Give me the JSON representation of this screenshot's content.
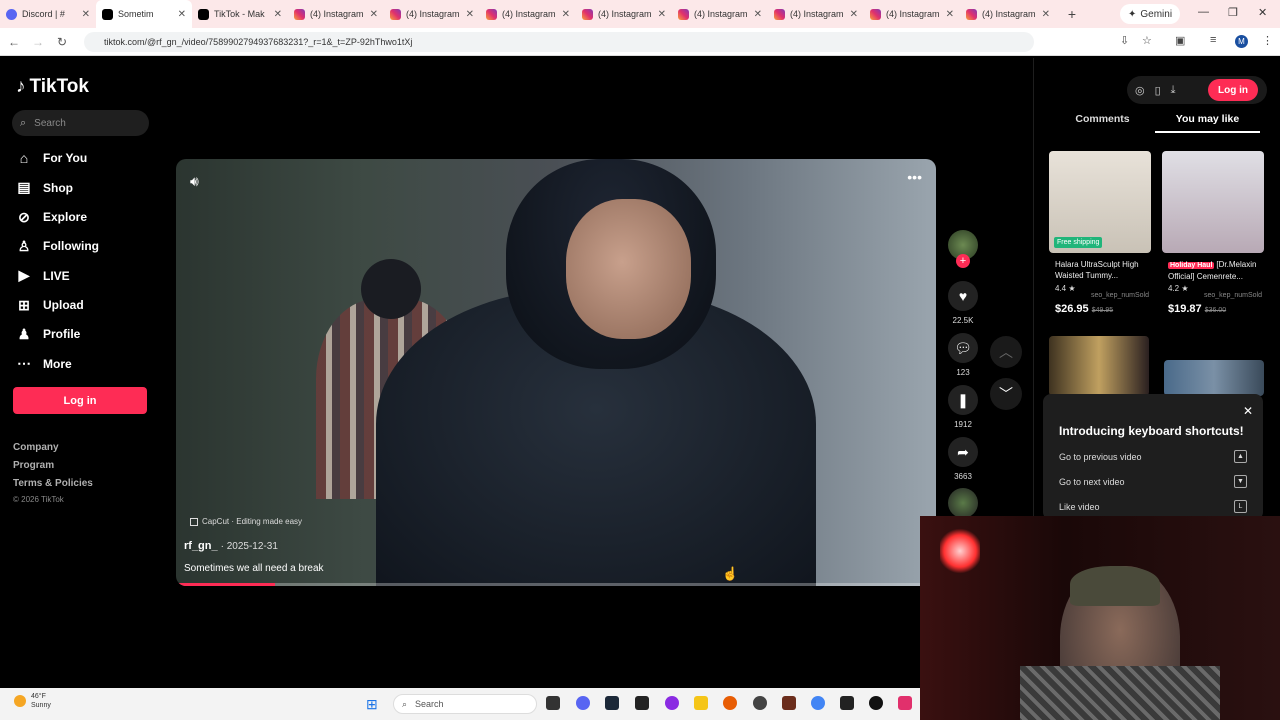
{
  "browser": {
    "tabs": [
      {
        "title": "Discord | #",
        "kind": "dc"
      },
      {
        "title": "Sometim",
        "kind": "tt",
        "active": true
      },
      {
        "title": "TikTok - Mak",
        "kind": "tt"
      },
      {
        "title": "(4) Instagram",
        "kind": "ig"
      },
      {
        "title": "(4) Instagram",
        "kind": "ig"
      },
      {
        "title": "(4) Instagram",
        "kind": "ig"
      },
      {
        "title": "(4) Instagram",
        "kind": "ig"
      },
      {
        "title": "(4) Instagram",
        "kind": "ig"
      },
      {
        "title": "(4) Instagram",
        "kind": "ig"
      },
      {
        "title": "(4) Instagram",
        "kind": "ig"
      },
      {
        "title": "(4) Instagram",
        "kind": "ig"
      }
    ],
    "gemini_label": "Gemini",
    "url": "tiktok.com/@rf_gn_/video/7589902794937683231?_r=1&_t=ZP-92hThwo1tXj",
    "account_initial": "M"
  },
  "sidebar": {
    "logo": "TikTok",
    "search_placeholder": "Search",
    "nav": [
      {
        "label": "For You",
        "icon": "home-icon"
      },
      {
        "label": "Shop",
        "icon": "shop-icon"
      },
      {
        "label": "Explore",
        "icon": "compass-icon"
      },
      {
        "label": "Following",
        "icon": "following-icon"
      },
      {
        "label": "LIVE",
        "icon": "live-icon"
      },
      {
        "label": "Upload",
        "icon": "upload-icon"
      },
      {
        "label": "Profile",
        "icon": "profile-icon"
      },
      {
        "label": "More",
        "icon": "more-icon"
      }
    ],
    "login": "Log in",
    "footer": [
      "Company",
      "Program",
      "Terms & Policies"
    ],
    "copyright": "© 2026 TikTok"
  },
  "video": {
    "capcut": "CapCut · Editing made easy",
    "author": "rf_gn_",
    "date": "· 2025-12-31",
    "caption": "Sometimes we all need a break",
    "progress": 0.13
  },
  "actions": {
    "likes": "22.5K",
    "comments": "123",
    "saves": "1912",
    "shares": "3663"
  },
  "right_panel": {
    "login": "Log in",
    "tabs": [
      "Comments",
      "You may like"
    ],
    "products": [
      {
        "badge": "Free shipping",
        "title": "Halara UltraSculpt High Waisted Tummy...",
        "rating": "4.4 ★",
        "sold": "seo_kep_numSold",
        "price": "$26.95",
        "old_price": "$49.95"
      },
      {
        "tag": "Holiday Haul",
        "title": "[Dr.Melaxin Official] Cemenrete...",
        "rating": "4.2 ★",
        "sold": "seo_kep_numSold",
        "price": "$19.87",
        "old_price": "$36.00"
      }
    ],
    "shortcuts": {
      "title": "Introducing keyboard shortcuts!",
      "rows": [
        {
          "label": "Go to previous video",
          "key": "▲"
        },
        {
          "label": "Go to next video",
          "key": "▼"
        },
        {
          "label": "Like video",
          "key": "L"
        }
      ]
    }
  },
  "taskbar": {
    "temp": "46°F",
    "condition": "Sunny",
    "search": "Search"
  },
  "colors": {
    "accent": "#fe2c55",
    "bg": "#000000"
  }
}
